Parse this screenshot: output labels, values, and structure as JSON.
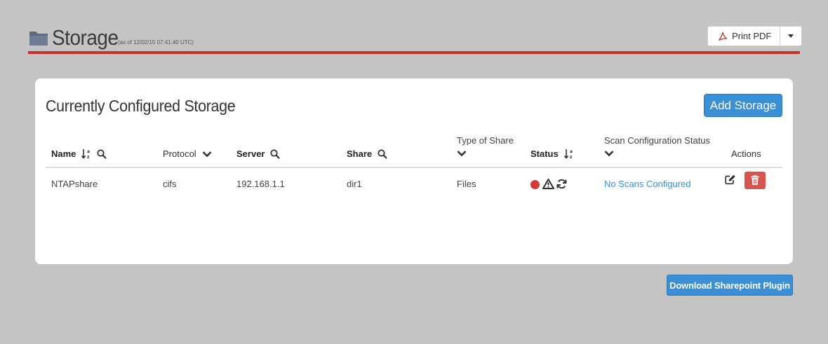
{
  "header": {
    "title": "Storage",
    "timestamp": "(as of 12/02/15 07:41:40 UTC)",
    "print_label": "Print PDF"
  },
  "panel": {
    "title": "Currently Configured Storage",
    "add_label": "Add Storage"
  },
  "table": {
    "columns": {
      "name": "Name",
      "protocol": "Protocol",
      "server": "Server",
      "share": "Share",
      "type": "Type of Share",
      "status": "Status",
      "scan": "Scan Configuration Status",
      "actions": "Actions"
    },
    "rows": [
      {
        "name": "NTAPshare",
        "protocol": "cifs",
        "server": "192.168.1.1",
        "share": "dir1",
        "type": "Files",
        "status_icons": [
          "red-dot-icon",
          "warning-icon",
          "refresh-icon"
        ],
        "scan": "No Scans Configured"
      }
    ]
  },
  "footer": {
    "download_label": "Download Sharepoint Plugin"
  },
  "colors": {
    "accent_blue": "#3a8fd6",
    "header_red": "#c9302c",
    "status_red": "#d43a35",
    "delete_red": "#d9534f"
  }
}
